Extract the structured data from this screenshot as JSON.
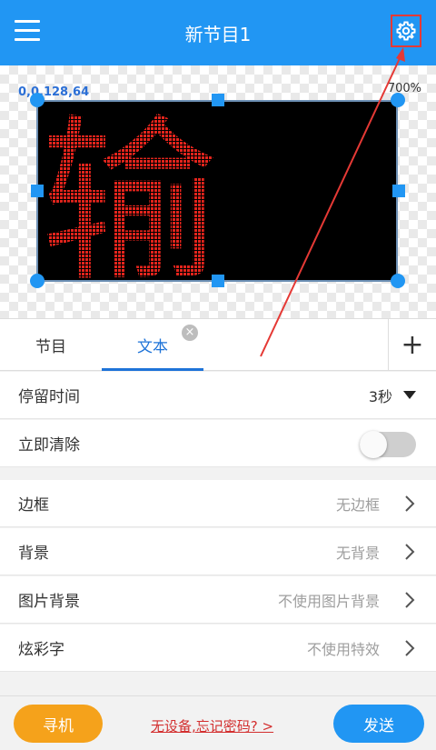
{
  "header": {
    "title": "新节目1",
    "menu_icon": "hamburger-menu-icon",
    "settings_icon": "gear-icon"
  },
  "canvas": {
    "coords": "0,0,128,64",
    "zoom": "700%",
    "led_text": "输",
    "led_color": "#e3241c"
  },
  "tabs": [
    {
      "label": "节目",
      "active": false
    },
    {
      "label": "文本",
      "active": true
    }
  ],
  "settings": {
    "dwell": {
      "label": "停留时间",
      "value": "3秒"
    },
    "clear": {
      "label": "立即清除",
      "on": false
    },
    "border": {
      "label": "边框",
      "value": "无边框"
    },
    "background": {
      "label": "背景",
      "value": "无背景"
    },
    "image_bg": {
      "label": "图片背景",
      "value": "不使用图片背景"
    },
    "colorful": {
      "label": "炫彩字",
      "value": "不使用特效"
    }
  },
  "bottom": {
    "find": "寻机",
    "help": "无设备,忘记密码? >",
    "send": "发送"
  },
  "colors": {
    "primary": "#2196f3",
    "accent_orange": "#f5a21b",
    "annotation_red": "#e53935"
  }
}
